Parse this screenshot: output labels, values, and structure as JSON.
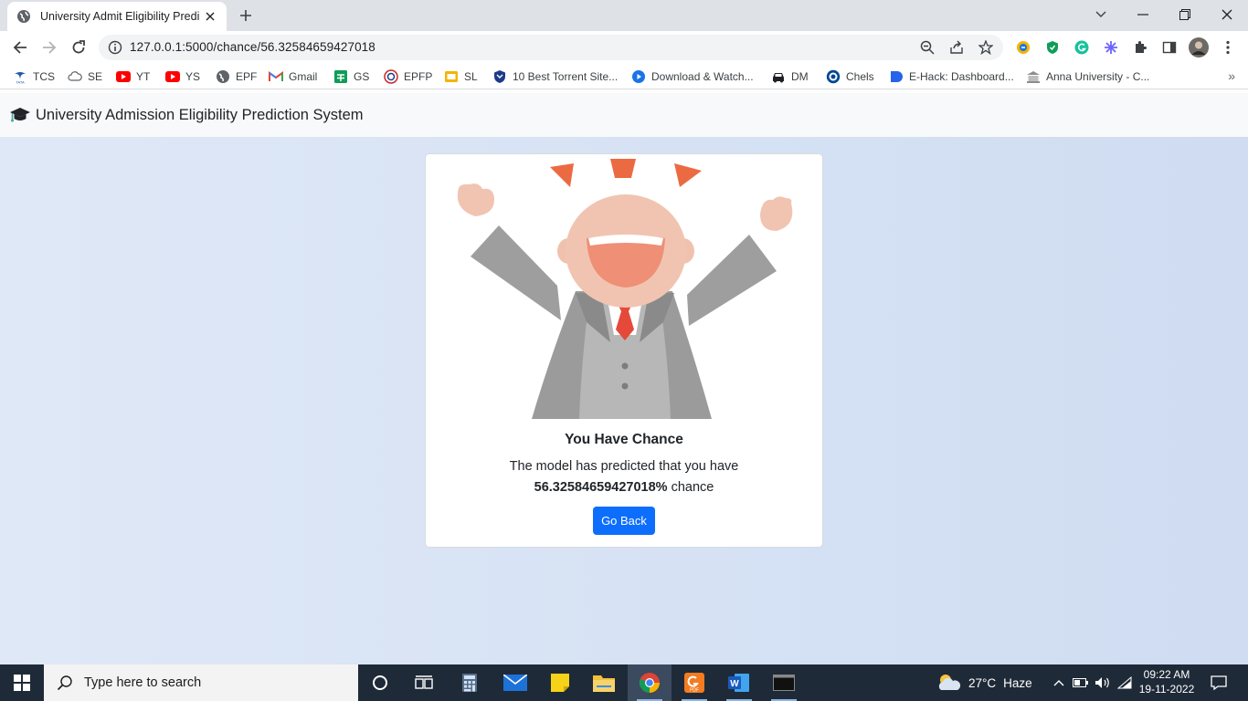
{
  "browser": {
    "tab": {
      "title": "University Admit Eligibility Prediction System"
    },
    "url": "127.0.0.1:5000/chance/56.32584659427018",
    "bookmarks": [
      {
        "label": "TCS",
        "icon": "tata-icon"
      },
      {
        "label": "SE",
        "icon": "cloud-icon"
      },
      {
        "label": "YT",
        "icon": "youtube-icon"
      },
      {
        "label": "YS",
        "icon": "youtube-icon"
      },
      {
        "label": "EPF",
        "icon": "globe-icon"
      },
      {
        "label": "Gmail",
        "icon": "gmail-icon"
      },
      {
        "label": "GS",
        "icon": "sheets-icon"
      },
      {
        "label": "EPFP",
        "icon": "epfo-icon"
      },
      {
        "label": "SL",
        "icon": "slides-icon"
      },
      {
        "label": "10 Best Torrent Site...",
        "icon": "shield-icon"
      },
      {
        "label": "Download & Watch...",
        "icon": "play-icon"
      },
      {
        "label": "DM",
        "icon": "car-icon"
      },
      {
        "label": "Chels",
        "icon": "chelsea-icon"
      },
      {
        "label": "E-Hack: Dashboard...",
        "icon": "ehack-icon"
      },
      {
        "label": "Anna University - C...",
        "icon": "university-icon"
      }
    ]
  },
  "page": {
    "navbar": {
      "brand": "University Admission Eligibility Prediction System"
    },
    "card": {
      "title": "You Have Chance",
      "text_line1": "The model has predicted that you have",
      "chance_value": "56.32584659427018%",
      "chance_suffix": " chance",
      "button_label": "Go Back"
    }
  },
  "taskbar": {
    "search_placeholder": "Type here to search",
    "weather": {
      "temp": "27°C",
      "condition": "Haze"
    },
    "clock": {
      "time": "09:22 AM",
      "date": "19-11-2022"
    }
  },
  "colors": {
    "accent": "#0d6efd",
    "page_bg": "#d8e3f5",
    "taskbar": "#1f2a38"
  }
}
